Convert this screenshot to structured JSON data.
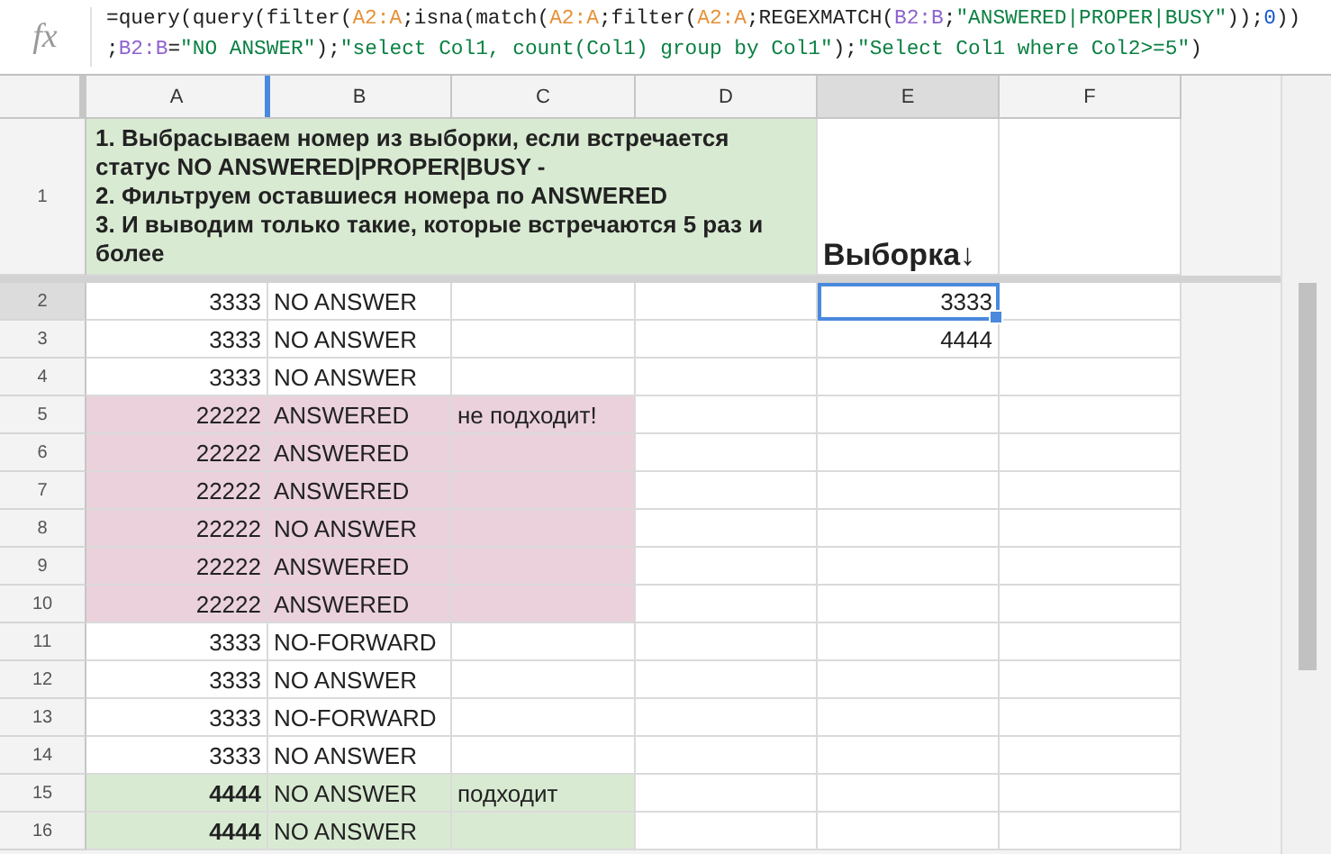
{
  "formula_bar": {
    "icon": "fx",
    "lines": [
      [
        {
          "kind": "plain",
          "text": "=query(query(filter("
        },
        {
          "kind": "ref",
          "text": "A2:A",
          "color": "#e69138"
        },
        {
          "kind": "plain",
          "text": ";isna(match("
        },
        {
          "kind": "ref",
          "text": "A2:A",
          "color": "#e69138"
        },
        {
          "kind": "plain",
          "text": ";filter("
        },
        {
          "kind": "ref",
          "text": "A2:A",
          "color": "#e69138"
        },
        {
          "kind": "plain",
          "text": ";REGEXMATCH("
        },
        {
          "kind": "ref",
          "text": "B2:B",
          "color": "#8e63ce"
        },
        {
          "kind": "plain",
          "text": ";"
        },
        {
          "kind": "string",
          "text": "\"ANSWERED|PROPER|BUSY\""
        },
        {
          "kind": "plain",
          "text": "));"
        },
        {
          "kind": "number",
          "text": "0"
        },
        {
          "kind": "plain",
          "text": "))"
        }
      ],
      [
        {
          "kind": "plain",
          "text": ";"
        },
        {
          "kind": "ref",
          "text": "B2:B",
          "color": "#8e63ce"
        },
        {
          "kind": "plain",
          "text": "="
        },
        {
          "kind": "string",
          "text": "\"NO ANSWER\""
        },
        {
          "kind": "plain",
          "text": ");"
        },
        {
          "kind": "string",
          "text": "\"select Col1, count(Col1) group by Col1\""
        },
        {
          "kind": "plain",
          "text": ");"
        },
        {
          "kind": "string",
          "text": "\"Select Col1 where Col2>=5\""
        },
        {
          "kind": "plain",
          "text": ")"
        }
      ]
    ]
  },
  "columns": [
    {
      "label": "A",
      "selected": false
    },
    {
      "label": "B",
      "selected": false
    },
    {
      "label": "C",
      "selected": false
    },
    {
      "label": "D",
      "selected": false
    },
    {
      "label": "E",
      "selected": true
    },
    {
      "label": "F",
      "selected": false
    }
  ],
  "rows": [
    {
      "number": "1",
      "selected": false,
      "color": "#d9ead3",
      "cells": {
        "A": {
          "kind": "note",
          "filled": true,
          "bold": true,
          "lines": [
            "1. Выбрасываем номер из выборки, если встречается статус NO ANSWERED|PROPER|BUSY -",
            "2. Фильтруем оставшиеся номера по ANSWERED",
            "3. И выводим только такие, которые встречаются 5 раз и более"
          ]
        },
        "E": {
          "kind": "heading",
          "text": "Выборка↓",
          "bold": true
        }
      }
    },
    {
      "number": "2",
      "selected": true,
      "cells": {
        "A": {
          "kind": "number",
          "text": "3333"
        },
        "B": {
          "kind": "text",
          "text": "NO ANSWER"
        },
        "E": {
          "kind": "number",
          "text": "3333",
          "selected": true
        }
      }
    },
    {
      "number": "3",
      "selected": false,
      "cells": {
        "A": {
          "kind": "number",
          "text": "3333"
        },
        "B": {
          "kind": "text",
          "text": "NO ANSWER"
        },
        "E": {
          "kind": "number",
          "text": "4444",
          "selected": false
        }
      }
    },
    {
      "number": "4",
      "selected": false,
      "cells": {
        "A": {
          "kind": "number",
          "text": "3333"
        },
        "B": {
          "kind": "text",
          "text": "NO ANSWER"
        }
      }
    },
    {
      "number": "5",
      "selected": false,
      "color": "#ead1dc",
      "cells": {
        "A": {
          "kind": "number",
          "text": "22222",
          "filled": true
        },
        "B": {
          "kind": "text",
          "text": "ANSWERED",
          "filled": true
        },
        "C": {
          "kind": "text",
          "text": "не подходит!",
          "filled": true
        }
      }
    },
    {
      "number": "6",
      "selected": false,
      "color": "#ead1dc",
      "cells": {
        "A": {
          "kind": "number",
          "text": "22222",
          "filled": true
        },
        "B": {
          "kind": "text",
          "text": "ANSWERED",
          "filled": true
        },
        "C": {
          "kind": "empty",
          "filled": true
        }
      }
    },
    {
      "number": "7",
      "selected": false,
      "color": "#ead1dc",
      "cells": {
        "A": {
          "kind": "number",
          "text": "22222",
          "filled": true
        },
        "B": {
          "kind": "text",
          "text": "ANSWERED",
          "filled": true
        },
        "C": {
          "kind": "empty",
          "filled": true
        }
      }
    },
    {
      "number": "8",
      "selected": false,
      "color": "#ead1dc",
      "cells": {
        "A": {
          "kind": "number",
          "text": "22222",
          "filled": true
        },
        "B": {
          "kind": "text",
          "text": "NO ANSWER",
          "filled": true
        },
        "C": {
          "kind": "empty",
          "filled": true
        }
      }
    },
    {
      "number": "9",
      "selected": false,
      "color": "#ead1dc",
      "cells": {
        "A": {
          "kind": "number",
          "text": "22222",
          "filled": true
        },
        "B": {
          "kind": "text",
          "text": "ANSWERED",
          "filled": true
        },
        "C": {
          "kind": "empty",
          "filled": true
        }
      }
    },
    {
      "number": "10",
      "selected": false,
      "color": "#ead1dc",
      "cells": {
        "A": {
          "kind": "number",
          "text": "22222",
          "filled": true
        },
        "B": {
          "kind": "text",
          "text": "ANSWERED",
          "filled": true
        },
        "C": {
          "kind": "empty",
          "filled": true
        }
      }
    },
    {
      "number": "11",
      "selected": false,
      "cells": {
        "A": {
          "kind": "number",
          "text": "3333"
        },
        "B": {
          "kind": "text",
          "text": "NO-FORWARD"
        }
      }
    },
    {
      "number": "12",
      "selected": false,
      "cells": {
        "A": {
          "kind": "number",
          "text": "3333"
        },
        "B": {
          "kind": "text",
          "text": "NO ANSWER"
        }
      }
    },
    {
      "number": "13",
      "selected": false,
      "cells": {
        "A": {
          "kind": "number",
          "text": "3333"
        },
        "B": {
          "kind": "text",
          "text": "NO-FORWARD"
        }
      }
    },
    {
      "number": "14",
      "selected": false,
      "cells": {
        "A": {
          "kind": "number",
          "text": "3333"
        },
        "B": {
          "kind": "text",
          "text": "NO ANSWER"
        }
      }
    },
    {
      "number": "15",
      "selected": false,
      "color": "#d9ead3",
      "cells": {
        "A": {
          "kind": "number",
          "text": "4444",
          "bold": true,
          "filled": true
        },
        "B": {
          "kind": "text",
          "text": "NO ANSWER",
          "filled": true
        },
        "C": {
          "kind": "text",
          "text": "подходит",
          "filled": true
        }
      }
    },
    {
      "number": "16",
      "selected": false,
      "color": "#d9ead3",
      "cells": {
        "A": {
          "kind": "number",
          "text": "4444",
          "bold": true,
          "filled": true
        },
        "B": {
          "kind": "text",
          "text": "NO ANSWER",
          "filled": true
        },
        "C": {
          "kind": "empty",
          "filled": true
        }
      }
    }
  ]
}
